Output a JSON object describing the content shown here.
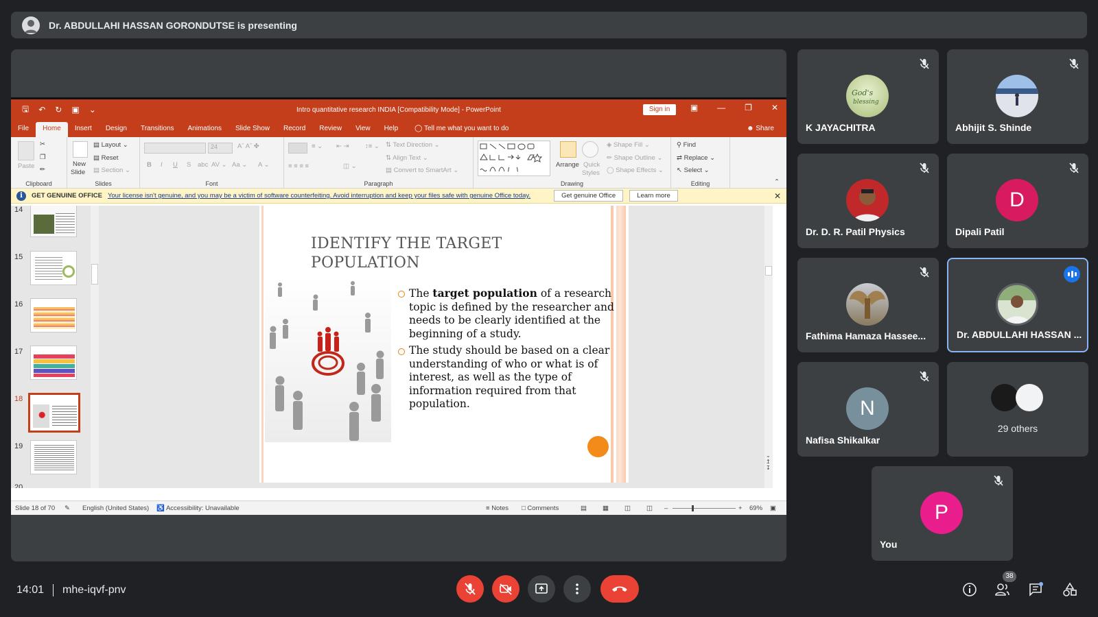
{
  "meeting": {
    "presenter_banner": "Dr. ABDULLAHI HASSAN GORONDUTSE is presenting",
    "time": "14:01",
    "code": "mhe-iqvf-pnv",
    "participants_count": "38"
  },
  "ppt": {
    "window_title": "Intro quantitative research INDIA [Compatibility Mode] - PowerPoint",
    "sign_in": "Sign in",
    "tabs": [
      "File",
      "Home",
      "Insert",
      "Design",
      "Transitions",
      "Animations",
      "Slide Show",
      "Record",
      "Review",
      "View",
      "Help"
    ],
    "tell_me": "Tell me what you want to do",
    "share": "Share",
    "ribbon": {
      "clipboard": {
        "label": "Clipboard",
        "paste": "Paste"
      },
      "slides": {
        "label": "Slides",
        "new_slide": "New",
        "new_slide2": "Slide",
        "layout": "Layout",
        "reset": "Reset",
        "section": "Section"
      },
      "font": {
        "label": "Font",
        "size": "24"
      },
      "paragraph": {
        "label": "Paragraph",
        "text_direction": "Text Direction",
        "align_text": "Align Text",
        "smartart": "Convert to SmartArt"
      },
      "drawing": {
        "label": "Drawing",
        "arrange": "Arrange",
        "quick_styles": "Quick",
        "quick_styles2": "Styles",
        "shape_fill": "Shape Fill",
        "shape_outline": "Shape Outline",
        "shape_effects": "Shape Effects"
      },
      "editing": {
        "label": "Editing",
        "find": "Find",
        "replace": "Replace",
        "select": "Select"
      }
    },
    "infobar": {
      "label": "GET GENUINE OFFICE",
      "message": "Your license isn't genuine, and you may be a victim of software counterfeiting. Avoid interruption and keep your files safe with genuine Office today.",
      "button1": "Get genuine Office",
      "button2": "Learn more"
    },
    "thumbnails": [
      "14",
      "15",
      "16",
      "17",
      "18",
      "19",
      "20"
    ],
    "selected_slide": "18",
    "slide": {
      "title_line1": "IDENTIFY THE TARGET",
      "title_line2": "POPULATION",
      "bullet1_a": "The ",
      "bullet1_bold": "target population",
      "bullet1_b": " of a research topic is defined by the researcher and needs to be clearly identified at the beginning of a study.",
      "bullet2": "The study should be based on a clear understanding of who or what is of interest, as well as the type of information required from that population."
    },
    "status": {
      "slide_of": "Slide 18 of 70",
      "language": "English (United States)",
      "accessibility": "Accessibility: Unavailable",
      "notes": "Notes",
      "comments": "Comments",
      "zoom": "69%"
    }
  },
  "participants": [
    {
      "name": "K JAYACHITRA",
      "muted": true
    },
    {
      "name": "Abhijit S. Shinde",
      "muted": true
    },
    {
      "name": "Dr. D. R. Patil Physics",
      "muted": true
    },
    {
      "name": "Dipali Patil",
      "initial": "D",
      "muted": true
    },
    {
      "name": "Fathima Hamaza Hassee...",
      "muted": true
    },
    {
      "name": "Dr. ABDULLAHI HASSAN ...",
      "speaking": true
    },
    {
      "name": "Nafisa Shikalkar",
      "initial": "N",
      "muted": true
    },
    {
      "name": "29 others"
    },
    {
      "name": "You",
      "initial": "P",
      "muted": true
    }
  ],
  "colors": {
    "ppt_accent": "#c43e1c",
    "meet_red": "#ea4335",
    "meet_bg": "#202124",
    "tile_bg": "#3c4043",
    "dipali": "#d81b60",
    "nafisa": "#78909c",
    "you": "#e91e8c"
  }
}
